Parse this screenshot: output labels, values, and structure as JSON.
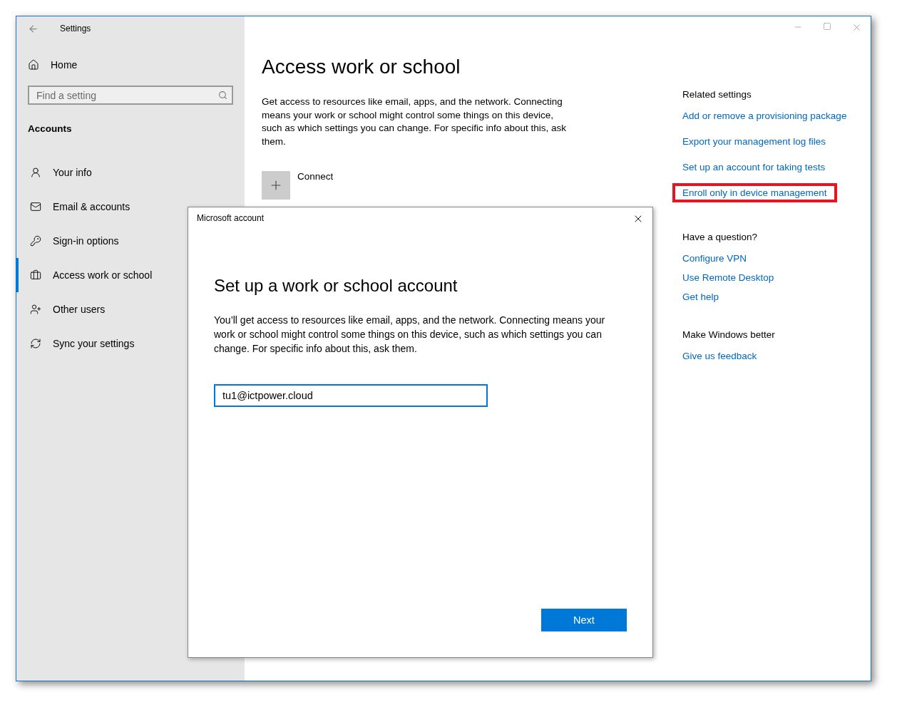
{
  "window": {
    "title": "Settings"
  },
  "sidebar": {
    "home": "Home",
    "search": {
      "placeholder": "Find a setting"
    },
    "section": "Accounts",
    "items": [
      {
        "label": "Your info",
        "selected": false
      },
      {
        "label": "Email & accounts",
        "selected": false
      },
      {
        "label": "Sign-in options",
        "selected": false
      },
      {
        "label": "Access work or school",
        "selected": true
      },
      {
        "label": "Other users",
        "selected": false
      },
      {
        "label": "Sync your settings",
        "selected": false
      }
    ]
  },
  "main": {
    "title": "Access work or school",
    "description": "Get access to resources like email, apps, and the network. Connecting means your work or school might control some things on this device, such as which settings you can change. For specific info about this, ask them.",
    "connect": "Connect"
  },
  "related": [
    {
      "heading": "Related settings",
      "links": [
        {
          "label": "Add or remove a provisioning package",
          "highlighted": false
        },
        {
          "label": "Export your management log files",
          "highlighted": false
        },
        {
          "label": "Set up an account for taking tests",
          "highlighted": false
        },
        {
          "label": "Enroll only in device management",
          "highlighted": true
        }
      ]
    },
    {
      "heading": "Have a question?",
      "links": [
        {
          "label": "Configure VPN",
          "highlighted": false
        },
        {
          "label": "Use Remote Desktop",
          "highlighted": false
        },
        {
          "label": "Get help",
          "highlighted": false
        }
      ]
    },
    {
      "heading": "Make Windows better",
      "links": [
        {
          "label": "Give us feedback",
          "highlighted": false
        }
      ]
    }
  ],
  "dialog": {
    "title": "Microsoft account",
    "heading": "Set up a work or school account",
    "text": "You’ll get access to resources like email, apps, and the network. Connecting means your work or school might control some things on this device, such as which settings you can change. For specific info about this, ask them.",
    "email": {
      "value": "tu1@ictpower.cloud"
    },
    "button": "Next"
  }
}
